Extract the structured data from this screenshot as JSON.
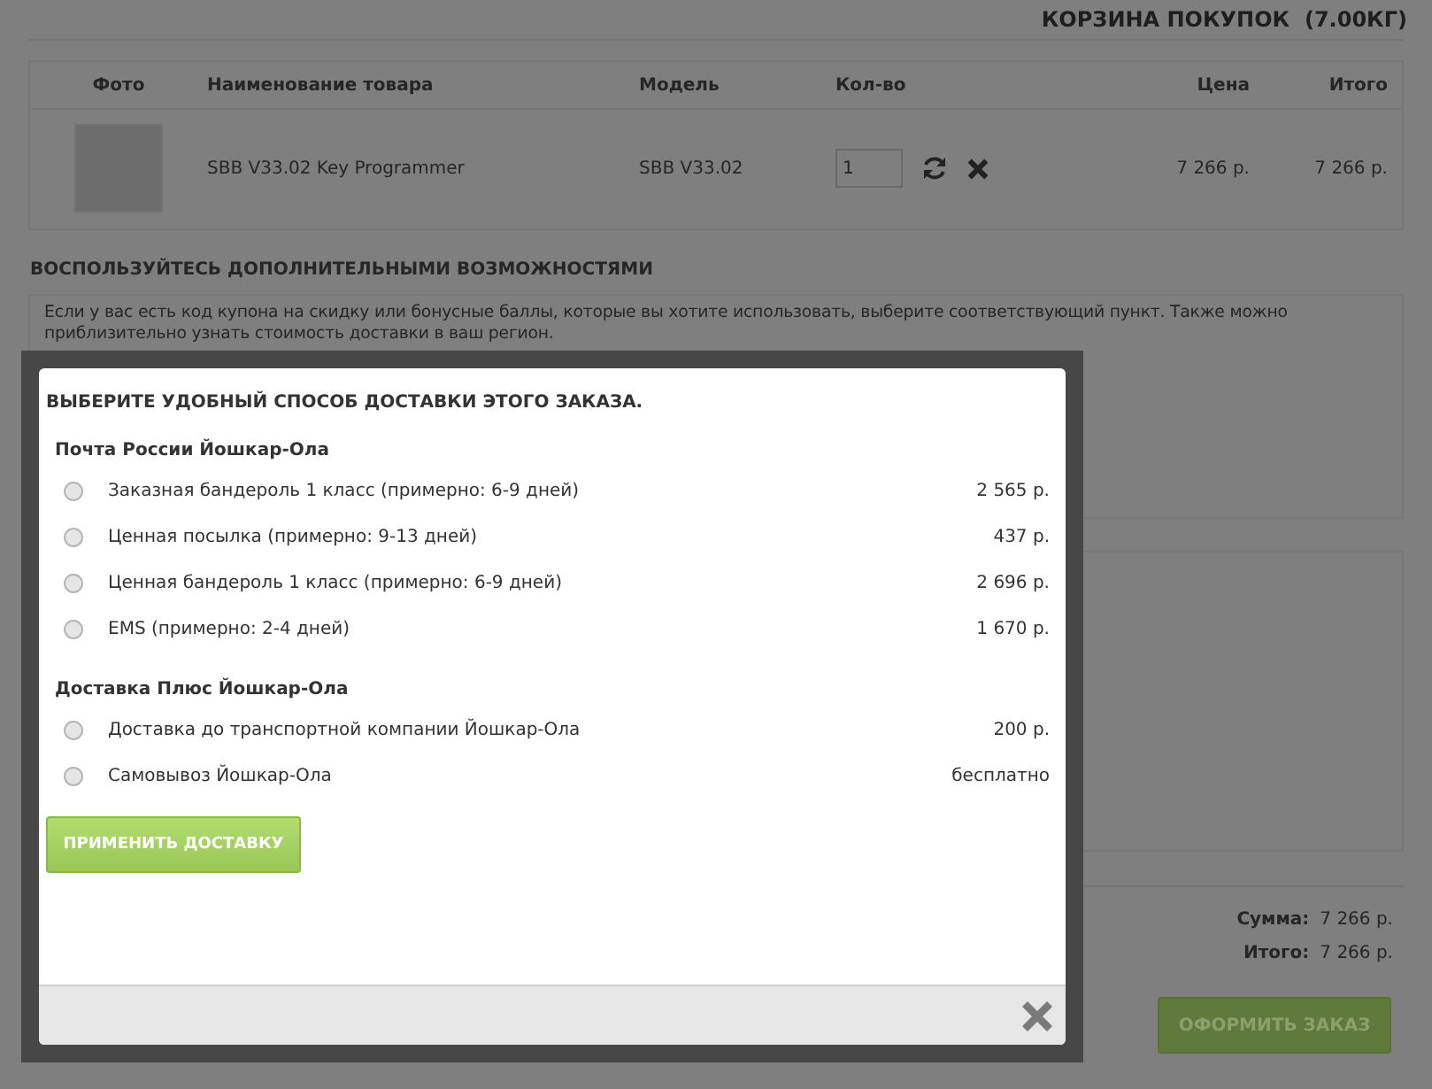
{
  "cart": {
    "title": "КОРЗИНА ПОКУПОК  (7.00КГ)",
    "columns": [
      "Фото",
      "Наименование товара",
      "Модель",
      "Кол-во",
      "Цена",
      "Итого"
    ],
    "items": [
      {
        "name": "SBB V33.02 Key Programmer",
        "model": "SBB V33.02",
        "quantity": "1",
        "price": "7 266 р.",
        "total": "7 266 р."
      }
    ]
  },
  "extras": {
    "heading": "ВОСПОЛЬЗУЙТЕСЬ ДОПОЛНИТЕЛЬНЫМИ ВОЗМОЖНОСТЯМИ",
    "text": "Если у вас есть код купона на скидку или бонусные баллы, которые вы хотите использовать, выберите соответствующий пункт. Также можно приблизительно узнать стоимость доставки в ваш регион."
  },
  "totals": [
    {
      "label": "Сумма:",
      "value": "7 266 р."
    },
    {
      "label": "Итого:",
      "value": "7 266 р."
    }
  ],
  "checkout_button": "ОФОРМИТЬ ЗАКАЗ",
  "modal": {
    "title": "ВЫБЕРИТЕ УДОБНЫЙ СПОСОБ ДОСТАВКИ ЭТОГО ЗАКАЗА.",
    "groups": [
      {
        "name": "Почта России Йошкар-Ола",
        "options": [
          {
            "label": "Заказная бандероль 1 класс (примерно: 6-9 дней)",
            "price": "2 565 р.",
            "selected": false
          },
          {
            "label": "Ценная посылка (примерно: 9-13 дней)",
            "price": "437 р.",
            "selected": false
          },
          {
            "label": "Ценная бандероль 1 класс (примерно: 6-9 дней)",
            "price": "2 696 р.",
            "selected": false
          },
          {
            "label": "EMS (примерно: 2-4 дней)",
            "price": "1 670 р.",
            "selected": false
          }
        ]
      },
      {
        "name": "Доставка Плюс Йошкар-Ола",
        "options": [
          {
            "label": "Доставка до транспортной компании Йошкар-Ола",
            "price": "200 р.",
            "selected": false
          },
          {
            "label": "Самовывоз Йошкар-Ола",
            "price": "бесплатно",
            "selected": false
          }
        ]
      }
    ],
    "apply_button": "ПРИМЕНИТЬ ДОСТАВКУ"
  }
}
